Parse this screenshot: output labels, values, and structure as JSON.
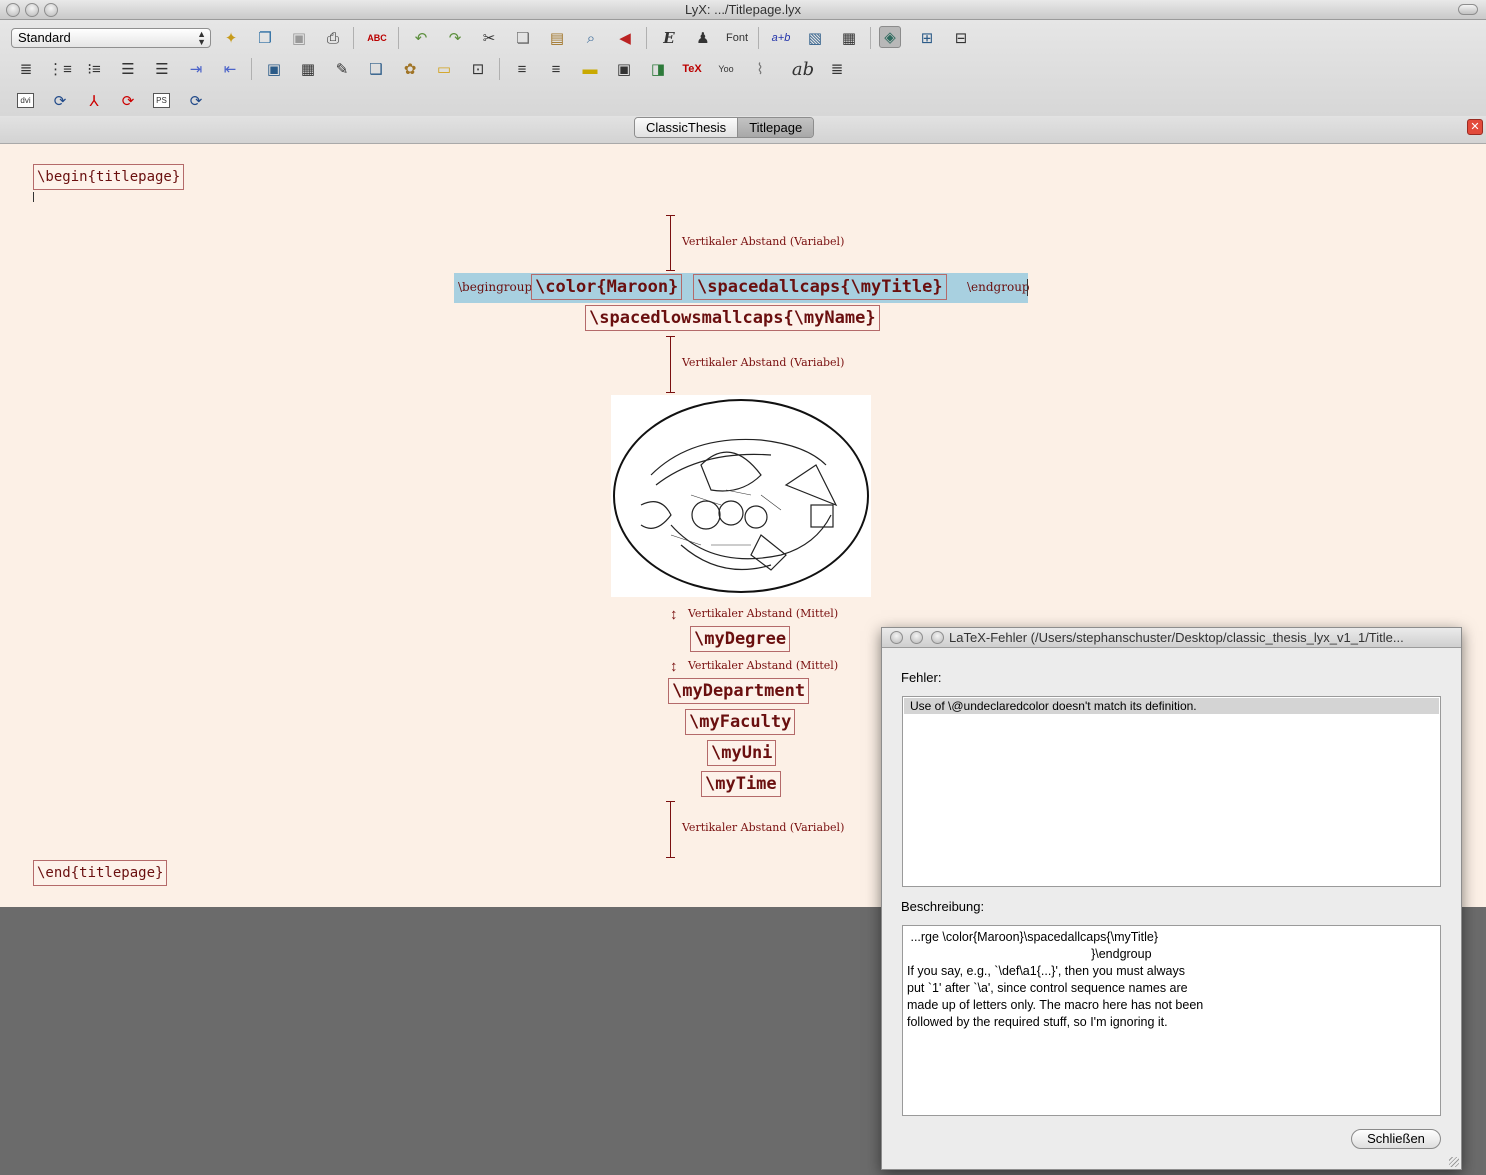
{
  "window": {
    "title": "LyX: .../Titlepage.lyx"
  },
  "toolbar": {
    "style_select": "Standard",
    "font_label": "Font",
    "spell_label": "ABC",
    "tex_label": "TeX",
    "ab_label": "ab",
    "row1_icons": [
      "new-icon",
      "open-icon",
      "save-icon",
      "print-icon",
      "spellcheck-icon",
      "undo-icon",
      "redo-icon",
      "cut-icon",
      "copy-icon",
      "paste-icon",
      "find-icon",
      "back-icon",
      "emphasis-icon",
      "noun-icon",
      "font-icon",
      "math-icon",
      "figure-icon",
      "table-icon",
      "toc-icon",
      "math-panel-icon",
      "tabular-icon"
    ],
    "row3_labels": [
      "dvi",
      "dvi",
      "pdf",
      "pdf",
      "PS",
      "PS"
    ]
  },
  "tabs": [
    {
      "label": "ClassicThesis",
      "active": false
    },
    {
      "label": "Titlepage",
      "active": true
    }
  ],
  "document": {
    "begin": "\\begin{titlepage}",
    "vspace_var": "Vertikaler Abstand (Variabel)",
    "vspace_med": "Vertikaler Abstand (Mittel)",
    "begingroup": "\\begingroup",
    "color": "\\color{Maroon}",
    "title": "\\spacedallcaps{\\myTitle}",
    "endgroup": "\\endgroup",
    "name": "\\spacedlowsmallcaps{\\myName}",
    "degree": "\\myDegree",
    "department": "\\myDepartment",
    "faculty": "\\myFaculty",
    "uni": "\\myUni",
    "time": "\\myTime",
    "end": "\\end{titlepage}"
  },
  "dialog": {
    "title": "LaTeX-Fehler (/Users/stephanschuster/Desktop/classic_thesis_lyx_v1_1/Title...",
    "errors_label": "Fehler:",
    "errors": [
      "Use of \\@undeclaredcolor doesn't match its definition."
    ],
    "description_label": "Beschreibung:",
    "description": " ...rge \\color{Maroon}\\spacedallcaps{\\myTitle}\n                                                     }\\endgroup\nIf you say, e.g., `\\def\\a1{...}', then you must always\nput `1' after `\\a', since control sequence names are\nmade up of letters only. The macro here has not been\nfollowed by the required stuff, so I'm ignoring it.",
    "close_button": "Schließen"
  }
}
